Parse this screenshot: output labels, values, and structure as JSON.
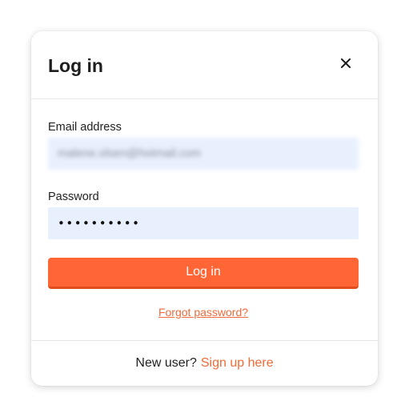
{
  "dialog": {
    "title": "Log in",
    "close_icon": "close-icon"
  },
  "form": {
    "email_label": "Email address",
    "email_value": "malene.olsen@hotmail.com",
    "password_label": "Password",
    "password_value": "••••••••••",
    "submit_label": "Log in",
    "forgot_label": "Forgot password?"
  },
  "footer": {
    "prompt": "New user?",
    "signup_label": "Sign up here"
  },
  "colors": {
    "accent": "#ff6535",
    "input_background": "#e8f0fe",
    "link": "#ef6a3c"
  }
}
